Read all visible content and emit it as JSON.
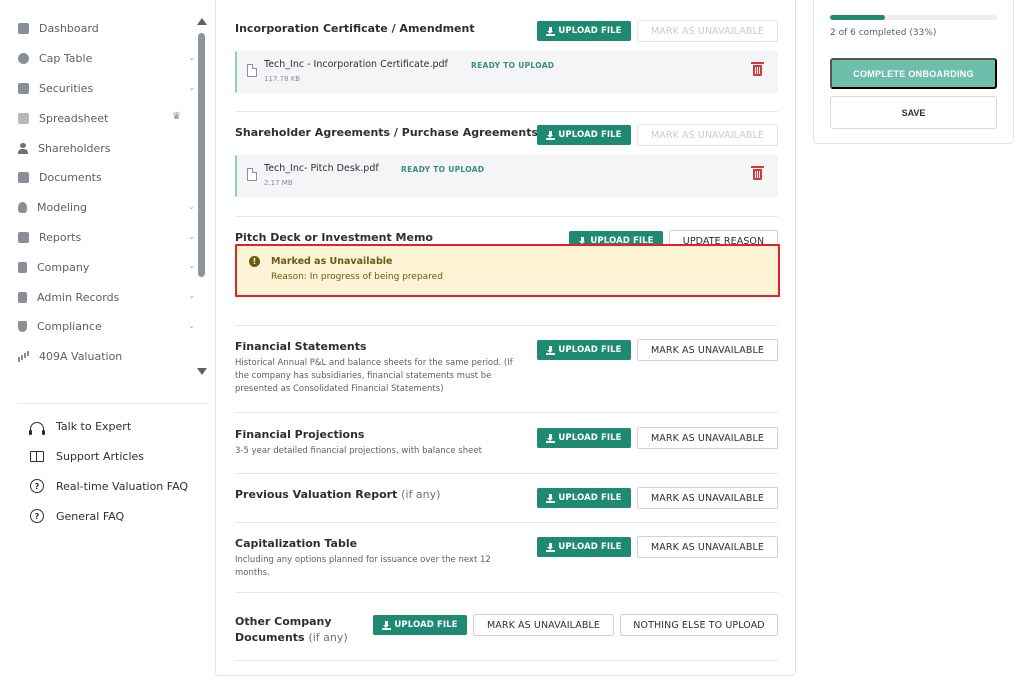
{
  "sidebar": {
    "items": [
      {
        "label": "Dashboard",
        "icon": "dashboard-icon",
        "has_chevron": false
      },
      {
        "label": "Cap Table",
        "icon": "pie-chart-icon",
        "has_chevron": true
      },
      {
        "label": "Securities",
        "icon": "clipboard-icon",
        "has_chevron": true
      },
      {
        "label": "Spreadsheet",
        "icon": "table-icon",
        "has_chevron": false,
        "badge_icon": "crown-icon"
      },
      {
        "label": "Shareholders",
        "icon": "person-icon",
        "has_chevron": false
      },
      {
        "label": "Documents",
        "icon": "folder-icon",
        "has_chevron": false
      },
      {
        "label": "Modeling",
        "icon": "lightbulb-icon",
        "has_chevron": true
      },
      {
        "label": "Reports",
        "icon": "report-icon",
        "has_chevron": true
      },
      {
        "label": "Company",
        "icon": "building-icon",
        "has_chevron": true
      },
      {
        "label": "Admin Records",
        "icon": "records-icon",
        "has_chevron": true
      },
      {
        "label": "Compliance",
        "icon": "shield-icon",
        "has_chevron": true
      },
      {
        "label": "409A Valuation",
        "icon": "bar-chart-icon",
        "has_chevron": false
      }
    ],
    "support": [
      {
        "label": "Talk to Expert",
        "icon": "headset-icon"
      },
      {
        "label": "Support Articles",
        "icon": "book-icon"
      },
      {
        "label": "Real-time Valuation FAQ",
        "icon": "help-circle-icon"
      },
      {
        "label": "General FAQ",
        "icon": "help-circle-icon"
      }
    ]
  },
  "common": {
    "upload_label": "UPLOAD FILE",
    "mark_unavailable_label": "MARK AS UNAVAILABLE",
    "update_reason_label": "UPDATE REASON",
    "nothing_else_label": "NOTHING ELSE TO UPLOAD",
    "ready_status": "READY TO UPLOAD"
  },
  "sections": {
    "incorporation": {
      "title": "Incorporation Certificate / Amendment",
      "file": {
        "name": "Tech_Inc - Incorporation Certificate.pdf",
        "size": "117.78 KB"
      }
    },
    "shareholder": {
      "title": "Shareholder Agreements / Purchase Agreements",
      "file": {
        "name": "Tech_Inc- Pitch Desk.pdf",
        "size": "2.17 MB"
      }
    },
    "pitch_deck": {
      "title": "Pitch Deck or Investment Memo",
      "unavailable_title": "Marked as Unavailable",
      "unavailable_reason": "Reason: In progress of being prepared"
    },
    "financial_statements": {
      "title": "Financial Statements",
      "desc_lines": [
        "Historical Annual P&L and balance sheets for the same period. (If",
        "the company has subsidiaries, financial statements must be",
        "presented as Consolidated Financial Statements)"
      ]
    },
    "financial_projections": {
      "title": "Financial Projections",
      "desc_lines": [
        "3-5 year detailed financial projections, with balance sheet"
      ]
    },
    "previous_valuation": {
      "title": "Previous Valuation Report",
      "suffix": "(if any)"
    },
    "cap_table": {
      "title": "Capitalization Table",
      "desc_lines": [
        "Including any options planned for issuance over the next 12",
        "months."
      ]
    },
    "other_docs": {
      "title_line1": "Other Company",
      "title_line2": "Documents",
      "suffix": "(if any)"
    }
  },
  "progress": {
    "text": "2 of 6 completed (33%)",
    "fraction": 0.33,
    "complete_label": "COMPLETE ONBOARDING",
    "save_label": "SAVE"
  },
  "colors": {
    "accent": "#1f8a72",
    "accent_light": "#6dbfab",
    "danger": "#d23a3a",
    "warning_bg": "#fdf4d6",
    "warning_text": "#6b5a12"
  }
}
